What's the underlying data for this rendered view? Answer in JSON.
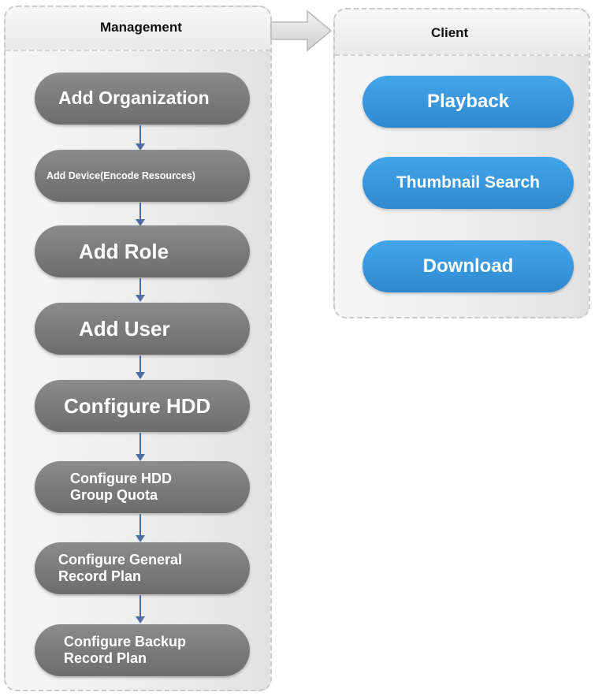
{
  "management": {
    "title": "Management",
    "steps": [
      "Add Organization",
      "Add Device(Encode Resources)",
      "Add Role",
      "Add User",
      "Configure HDD",
      "Configure HDD\nGroup Quota",
      "Configure General\nRecord Plan",
      "Configure Backup\nRecord Plan"
    ]
  },
  "client": {
    "title": "Client",
    "actions": [
      "Playback",
      "Thumbnail Search",
      "Download"
    ]
  },
  "colors": {
    "management_step": "#7b7b7b",
    "client_action": "#3996dc",
    "connector_arrow": "#4a6fa0"
  }
}
